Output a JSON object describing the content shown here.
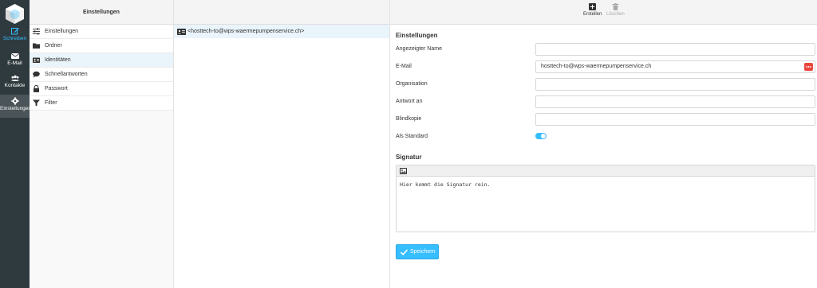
{
  "taskbar": {
    "compose": "Schreiben",
    "mail": "E-Mail",
    "contacts": "Kontakte",
    "settings": "Einstellungen"
  },
  "sidebar": {
    "title": "Einstellungen",
    "items": [
      {
        "label": "Einstellungen",
        "icon": "sliders-icon"
      },
      {
        "label": "Ordner",
        "icon": "folder-icon"
      },
      {
        "label": "Identitäten",
        "icon": "id-card-icon"
      },
      {
        "label": "Schnellantworten",
        "icon": "speech-bubble-icon"
      },
      {
        "label": "Passwort",
        "icon": "lock-icon"
      },
      {
        "label": "Filter",
        "icon": "funnel-icon"
      }
    ]
  },
  "identities": {
    "items": [
      {
        "label": "<hosttech-to@wps-waermepumpenservice.ch>"
      }
    ]
  },
  "toolbar": {
    "create": "Erstellen",
    "delete": "Löschen"
  },
  "form": {
    "section_title": "Einstellungen",
    "display_name_label": "Angezeigter Name",
    "display_name_value": "",
    "email_label": "E-Mail",
    "email_value": "hosttech-to@wps-waermepumpenservice.ch",
    "organization_label": "Organisation",
    "organization_value": "",
    "reply_to_label": "Antwort an",
    "reply_to_value": "",
    "bcc_label": "Blindkopie",
    "bcc_value": "",
    "default_label": "Als Standard",
    "default_on": true
  },
  "signature": {
    "title": "Signatur",
    "text": "Hier kommt die Signatur rein."
  },
  "save_label": "Speichern",
  "colors": {
    "accent": "#37beff",
    "taskbar": "#2f3a3f",
    "danger": "#e9473e"
  }
}
